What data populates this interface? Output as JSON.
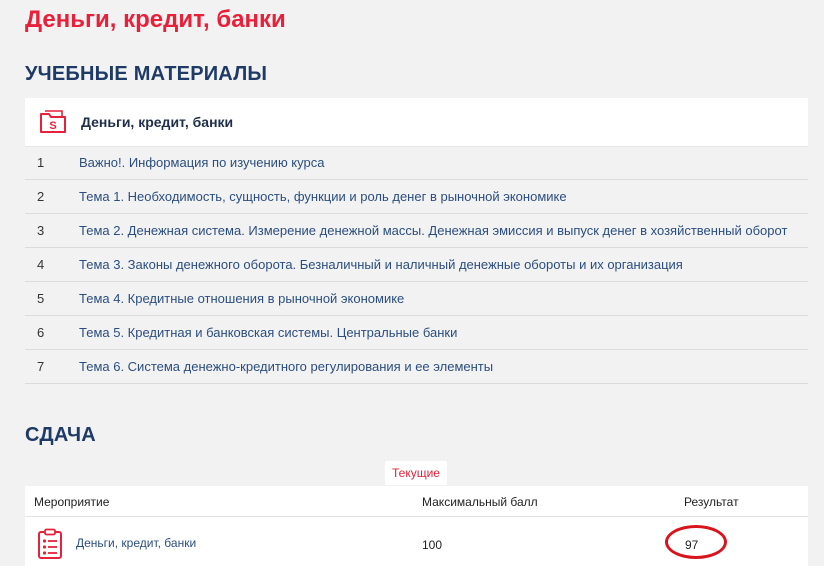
{
  "page": {
    "title": "Деньги, кредит, банки"
  },
  "materials": {
    "heading": "УЧЕБНЫЕ МАТЕРИАЛЫ",
    "course_name": "Деньги, кредит, банки",
    "course_icon": "presentation-folder-icon",
    "topics": [
      {
        "num": "1",
        "title": "Важно!. Информация по изучению курса"
      },
      {
        "num": "2",
        "title": "Тема 1. Необходимость, сущность, функции и роль денег в рыночной экономике"
      },
      {
        "num": "3",
        "title": "Тема 2. Денежная система. Измерение денежной массы. Денежная эмиссия и выпуск денег в хозяйственный оборот"
      },
      {
        "num": "4",
        "title": "Тема 3. Законы денежного оборота. Безналичный и наличный денежные обороты и их организация"
      },
      {
        "num": "5",
        "title": "Тема 4. Кредитные отношения в рыночной экономике"
      },
      {
        "num": "6",
        "title": "Тема 5. Кредитная и банковская системы. Центральные банки"
      },
      {
        "num": "7",
        "title": "Тема 6. Система денежно-кредитного регулирования и ее элементы"
      }
    ]
  },
  "submission": {
    "heading": "СДАЧА",
    "tab_current": "Текущие",
    "columns": {
      "event": "Мероприятие",
      "max_score": "Максимальный балл",
      "result": "Результат"
    },
    "rows": [
      {
        "event": "Деньги, кредит, банки",
        "max_score": "100",
        "result": "97",
        "icon": "checklist-icon"
      }
    ]
  },
  "colors": {
    "accent": "#e8203a",
    "heading": "#1e3a66",
    "link": "#2b4e80",
    "highlight": "#d8141c",
    "background": "#f2f2f2"
  }
}
